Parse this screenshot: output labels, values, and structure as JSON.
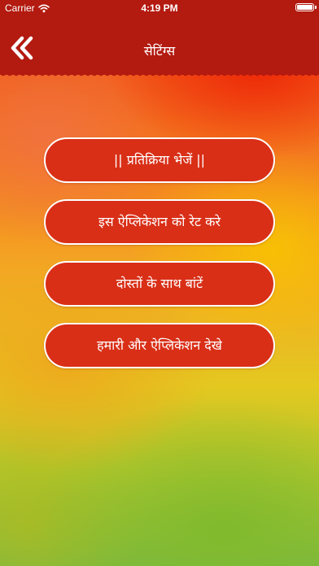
{
  "status_bar": {
    "carrier": "Carrier",
    "time": "4:19 PM",
    "wifi_icon": "wifi-icon",
    "battery_icon": "battery-icon",
    "battery_level": 1.0
  },
  "nav": {
    "back_icon": "double-chevron-left-icon",
    "title": "सेटिंग्स"
  },
  "menu": {
    "items": [
      {
        "label": "|| प्रतिक्रिया भेजें ||"
      },
      {
        "label": "इस ऐप्लिकेशन को रेट करे"
      },
      {
        "label": "दोस्तों के साथ बांटें"
      },
      {
        "label": "हमारी और ऐप्लिकेशन देखे"
      }
    ]
  },
  "colors": {
    "header": "#b31a10",
    "button_fill": "#d92f17",
    "button_border": "#ffffff",
    "text": "#ffffff"
  }
}
